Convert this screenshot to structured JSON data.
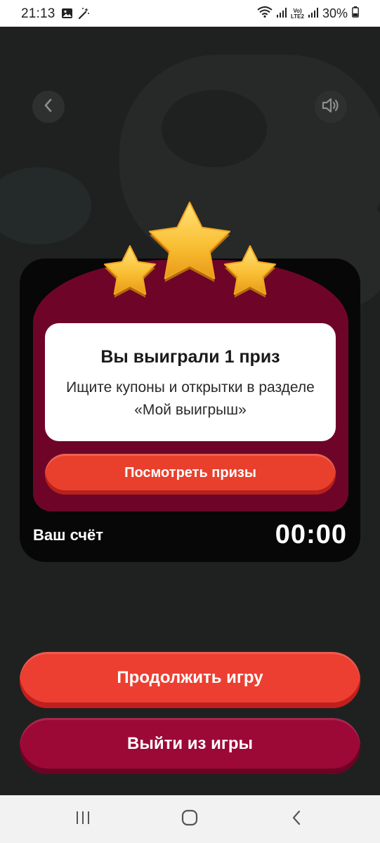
{
  "status_bar": {
    "time": "21:13",
    "carrier_badge_top": "Vo)",
    "carrier_badge_bottom": "LTE2",
    "battery_percent": "30%",
    "left_icons": [
      "image-icon",
      "magic-wand-icon"
    ],
    "right_icons": [
      "wifi-icon",
      "signal-icon",
      "signal-icon",
      "battery-icon"
    ]
  },
  "game": {
    "back_icon": "chevron-left-icon",
    "sound_icon": "speaker-icon",
    "stars_earned": 3,
    "result": {
      "title": "Вы выиграли 1 приз",
      "text": "Ищите купоны и открытки в разделе «Мой выигрыш»"
    },
    "view_prizes_label": "Посмотреть призы",
    "score_label": "Ваш счёт",
    "score_value": "00:00",
    "continue_label": "Продолжить игру",
    "exit_label": "Выйти из игры"
  },
  "nav_bar": {
    "icons": [
      "recent-apps-icon",
      "home-icon",
      "back-icon"
    ]
  },
  "colors": {
    "accent_red": "#ec3f31",
    "dark_red": "#9c0937",
    "card_maroon": "#6e0529",
    "star_gold": "#f6b62a"
  }
}
